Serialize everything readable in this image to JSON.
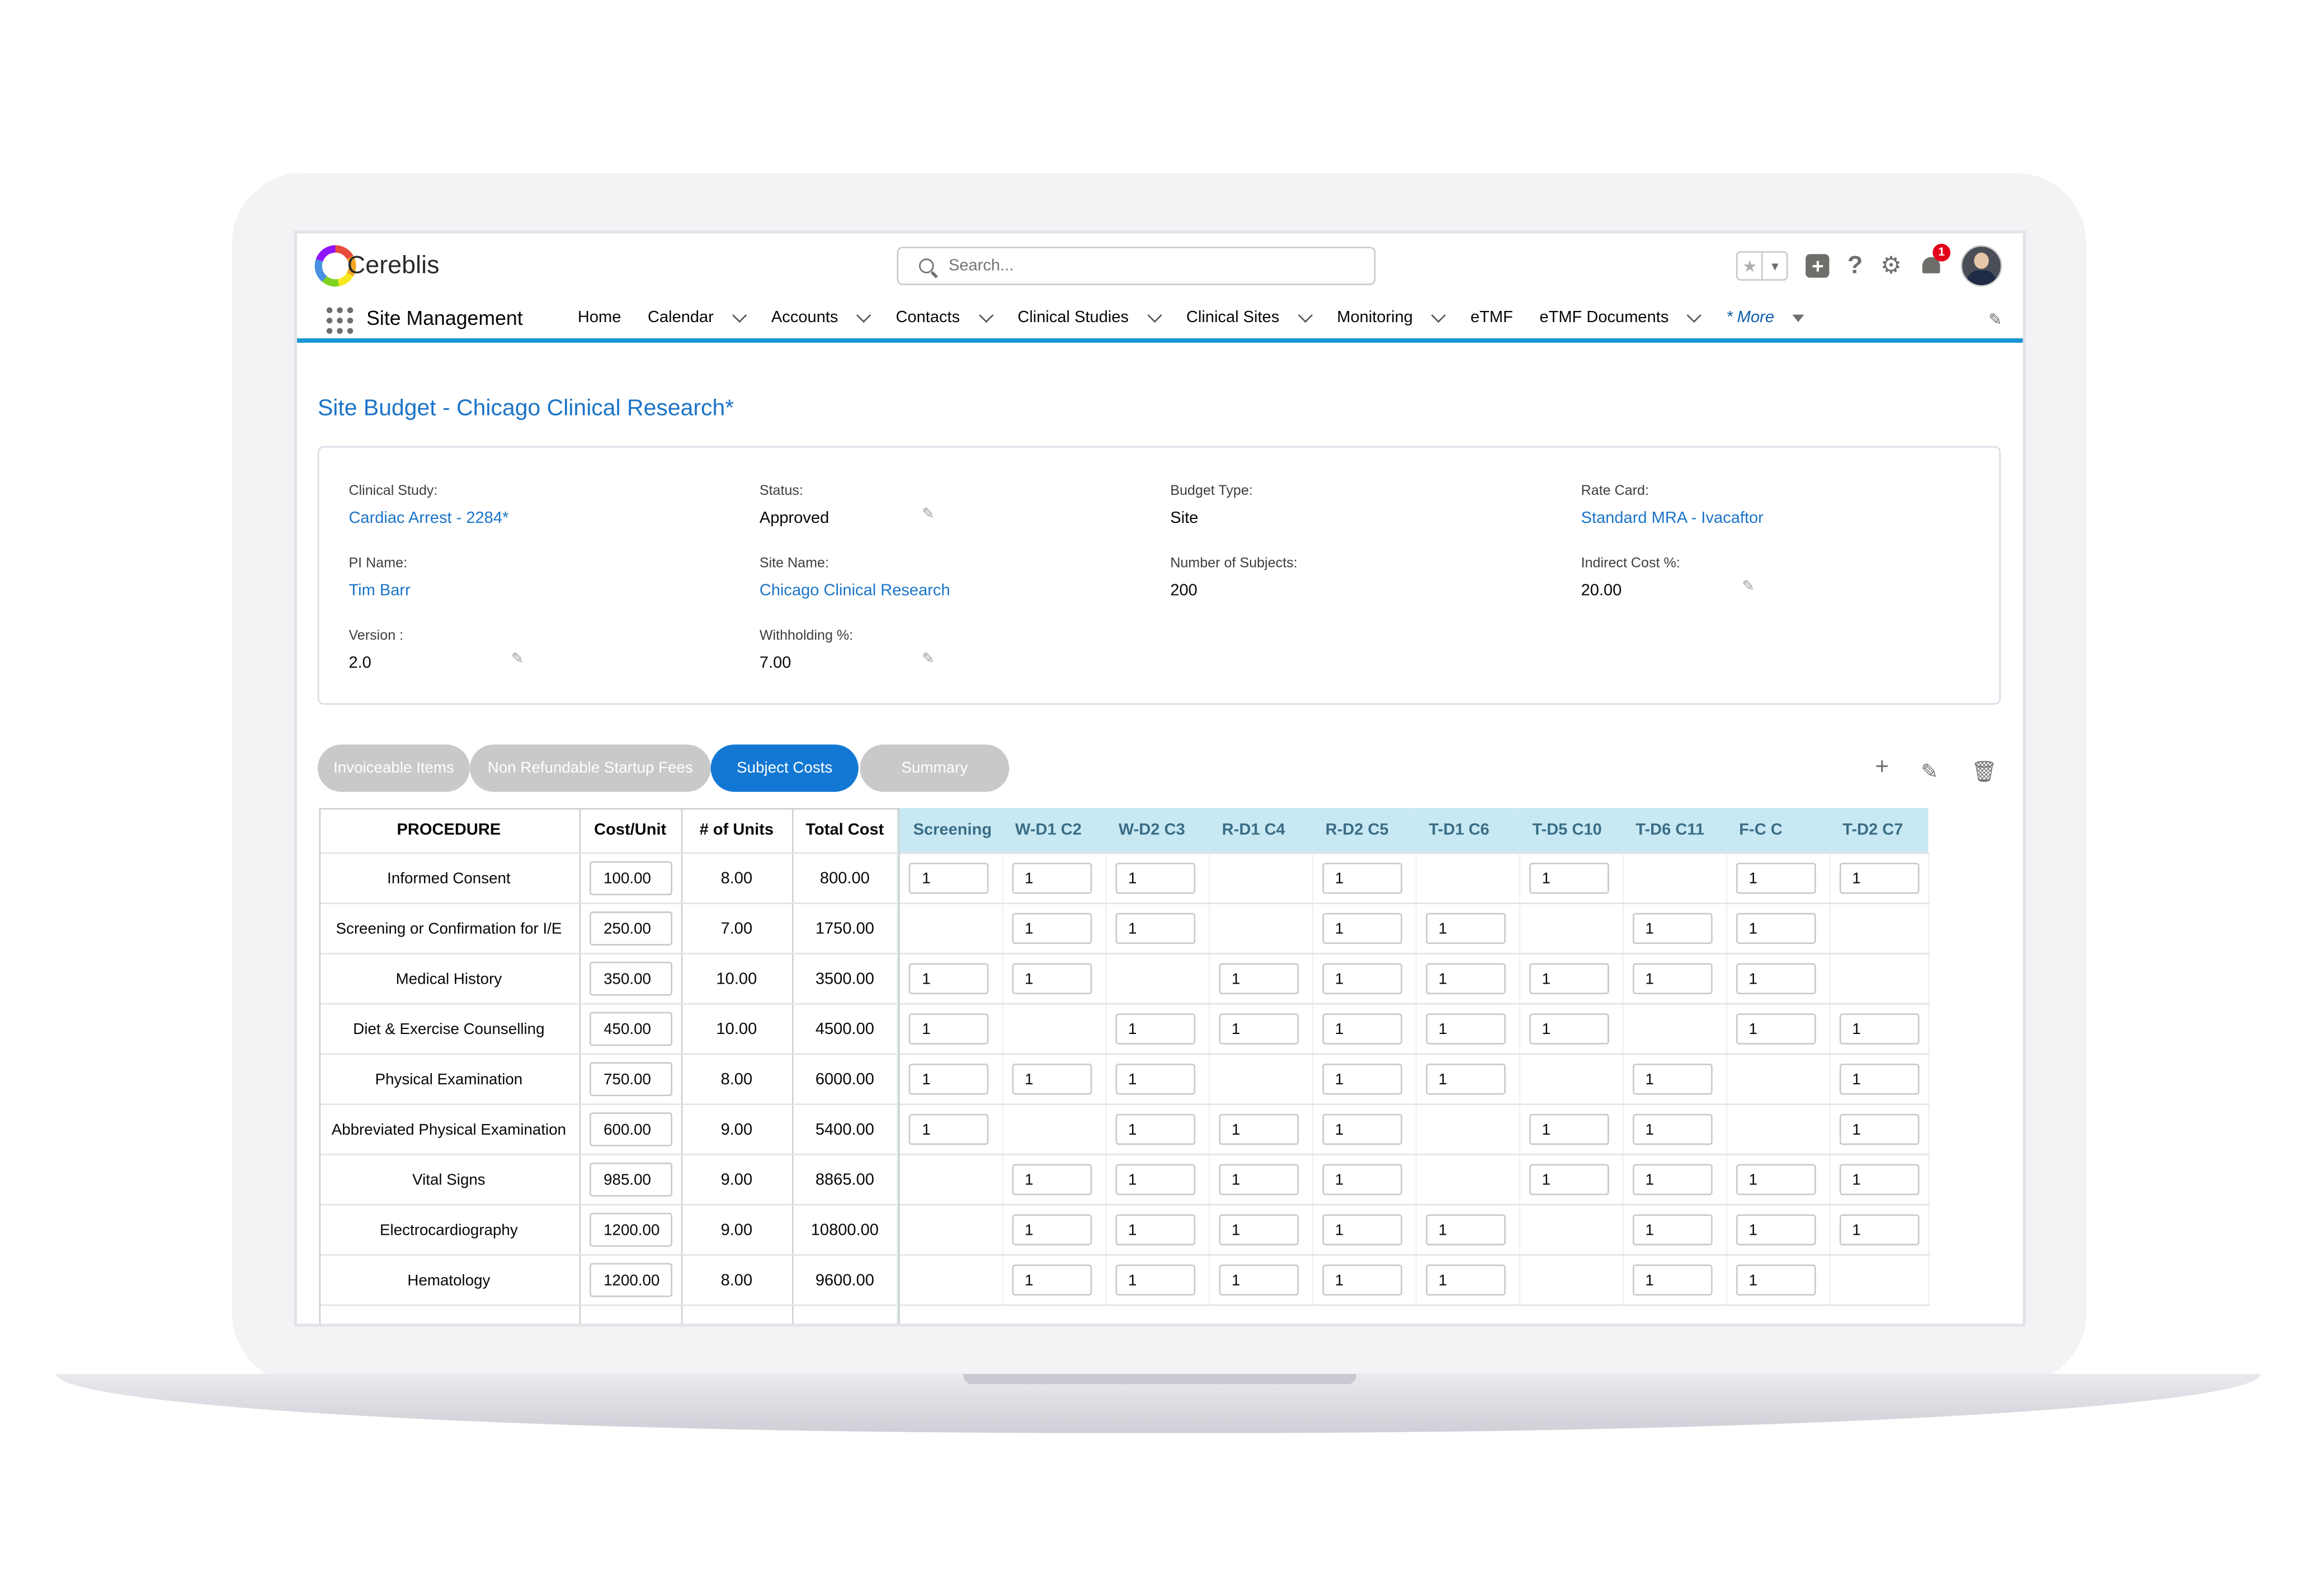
{
  "brand": {
    "logo_text": "Cereblis"
  },
  "search": {
    "placeholder": "Search..."
  },
  "header": {
    "notification_count": "1"
  },
  "nav": {
    "app_name": "Site Management",
    "items": [
      "Home",
      "Calendar",
      "Accounts",
      "Contacts",
      "Clinical Studies",
      "Clinical Sites",
      "Monitoring",
      "eTMF",
      "eTMF Documents"
    ],
    "more_label": "* More"
  },
  "page": {
    "title": "Site Budget - Chicago Clinical Research*"
  },
  "details": {
    "clinical_study": {
      "label": "Clinical Study:",
      "value": "Cardiac Arrest - 2284*"
    },
    "status": {
      "label": "Status:",
      "value": "Approved"
    },
    "budget_type": {
      "label": "Budget Type:",
      "value": "Site"
    },
    "rate_card": {
      "label": "Rate Card:",
      "value": "Standard MRA - Ivacaftor"
    },
    "pi_name": {
      "label": "PI Name:",
      "value": "Tim Barr"
    },
    "site_name": {
      "label": "Site Name:",
      "value": "Chicago Clinical Research"
    },
    "num_subjects": {
      "label": "Number of Subjects:",
      "value": "200"
    },
    "indirect_cost": {
      "label": "Indirect Cost %:",
      "value": "20.00"
    },
    "version": {
      "label": "Version :",
      "value": "2.0"
    },
    "withholding": {
      "label": "Withholding %:",
      "value": "7.00"
    }
  },
  "tabs": [
    "Invoiceable Items",
    "Non Refundable Startup Fees",
    "Subject Costs",
    "Summary"
  ],
  "active_tab": "Subject Costs",
  "colors": {
    "accent": "#1378d4",
    "link": "#1b74c8",
    "schedule_header": "#c8e9f3"
  },
  "table": {
    "headers": [
      "PROCEDURE",
      "Cost/Unit",
      "# of Units",
      "Total Cost"
    ],
    "schedule_headers": [
      "Screening",
      "W-D1 C2",
      "W-D2 C3",
      "R-D1 C4",
      "R-D2 C5",
      "T-D1 C6",
      "T-D5 C10",
      "T-D6 C11",
      "F-C C",
      "T-D2 C7"
    ],
    "rows": [
      {
        "procedure": "Informed Consent",
        "cost": "100.00",
        "units": "8.00",
        "total": "800.00",
        "cells": [
          "1",
          "1",
          "1",
          "",
          "1",
          "",
          "1",
          "",
          "1",
          "1"
        ]
      },
      {
        "procedure": "Screening or Confirmation for I/E",
        "cost": "250.00",
        "units": "7.00",
        "total": "1750.00",
        "cells": [
          "",
          "1",
          "1",
          "",
          "1",
          "1",
          "",
          "1",
          "1",
          ""
        ]
      },
      {
        "procedure": "Medical History",
        "cost": "350.00",
        "units": "10.00",
        "total": "3500.00",
        "cells": [
          "1",
          "1",
          "",
          "1",
          "1",
          "1",
          "1",
          "1",
          "1",
          ""
        ]
      },
      {
        "procedure": "Diet & Exercise Counselling",
        "cost": "450.00",
        "units": "10.00",
        "total": "4500.00",
        "cells": [
          "1",
          "",
          "1",
          "1",
          "1",
          "1",
          "1",
          "",
          "1",
          "1"
        ]
      },
      {
        "procedure": "Physical Examination",
        "cost": "750.00",
        "units": "8.00",
        "total": "6000.00",
        "cells": [
          "1",
          "1",
          "1",
          "",
          "1",
          "1",
          "",
          "1",
          "",
          "1"
        ]
      },
      {
        "procedure": "Abbreviated Physical Examination",
        "cost": "600.00",
        "units": "9.00",
        "total": "5400.00",
        "cells": [
          "1",
          "",
          "1",
          "1",
          "1",
          "",
          "1",
          "1",
          "",
          "1"
        ]
      },
      {
        "procedure": "Vital Signs",
        "cost": "985.00",
        "units": "9.00",
        "total": "8865.00",
        "cells": [
          "",
          "1",
          "1",
          "1",
          "1",
          "",
          "1",
          "1",
          "1",
          "1"
        ]
      },
      {
        "procedure": "Electrocardiography",
        "cost": "1200.00",
        "units": "9.00",
        "total": "10800.00",
        "cells": [
          "",
          "1",
          "1",
          "1",
          "1",
          "1",
          "",
          "1",
          "1",
          "1"
        ]
      },
      {
        "procedure": "Hematology",
        "cost": "1200.00",
        "units": "8.00",
        "total": "9600.00",
        "cells": [
          "",
          "1",
          "1",
          "1",
          "1",
          "1",
          "",
          "1",
          "1",
          ""
        ]
      }
    ]
  }
}
